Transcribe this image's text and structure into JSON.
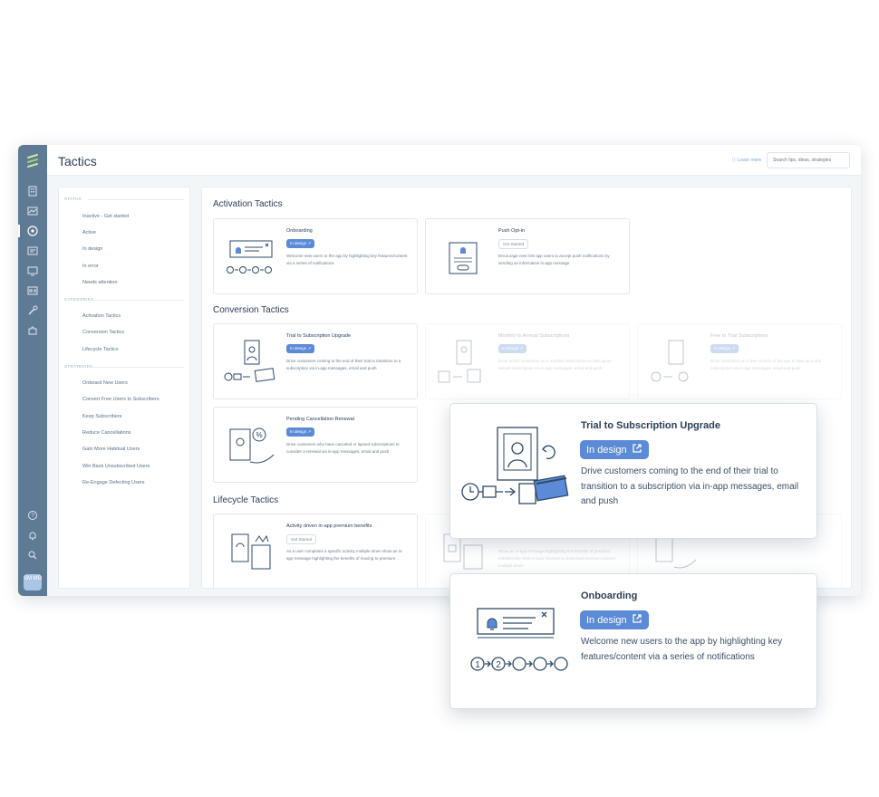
{
  "app": {
    "title": "Tactics",
    "learn_more": "Learn more",
    "search_placeholder": "Search tips, ideas, strategies",
    "avatar_initials": "SM MD"
  },
  "filters": {
    "status_header": "STATUS",
    "status": [
      "Inactive - Get started",
      "Active",
      "In design",
      "In error",
      "Needs attention"
    ],
    "categories_header": "CATEGORIES",
    "categories": [
      "Activation Tactics",
      "Conversion Tactics",
      "Lifecycle Tactics"
    ],
    "strategies_header": "STRATEGIES",
    "strategies": [
      "Onboard New Users",
      "Convert Free Users to Subscribers",
      "Keep Subscribers",
      "Reduce Cancellations",
      "Gain More Habitual Users",
      "Win Back Unsubscribed Users",
      "Re-Engage Defecting Users"
    ]
  },
  "sections": {
    "activation": "Activation Tactics",
    "conversion": "Conversion Tactics",
    "lifecycle": "Lifecycle Tactics"
  },
  "cards": {
    "onboarding": {
      "title": "Onboarding",
      "badge": "In design ↗",
      "desc": "Welcome new users to the app by highlighting key features/content via a series of notifications"
    },
    "push": {
      "title": "Push Opt-in",
      "badge": "Get Started",
      "desc": "Encourage new iOS app users to accept push notifications by sending an informative in-app message"
    },
    "trial": {
      "title": "Trial to Subscription Upgrade",
      "badge": "In design ↗",
      "desc": "Drive customers coming to the end of their trial to transition to a subscription via in-app messages, email and push"
    },
    "monthly": {
      "title": "Monthly to Annual Subscriptions",
      "badge": "In design ↗",
      "desc": "Drive active customers on a monthly subscription to take up an annual subscription via in-app messages, email and push"
    },
    "freetrial": {
      "title": "Free to Trial Subscriptions",
      "badge": "In design ↗",
      "desc": "Drive customers on a free version of the app to take up a trial subscription via in-app messages, email and push"
    },
    "pending": {
      "title": "Pending Cancellation Renewal",
      "badge": "In design ↗",
      "desc": "Drive customers who have canceled or lapsed subscriptions to consider a renewal via in-app messages, email and push"
    },
    "activity": {
      "title": "Activity driven in-app premium benefits",
      "badge": "Get Started",
      "desc": "As a user completes a specific activity multiple times show an in-app message highlighting the benefits of moving to premium"
    },
    "lifecycle2": {
      "desc": "Show an in-app message highlighting the benefits of premium membership when a user chooses to download premium content multiple times"
    }
  },
  "popups": {
    "trial": {
      "title": "Trial to Subscription Upgrade",
      "badge": "In design",
      "desc": "Drive customers coming to the end of their trial to transition to a subscription via in-app messages, email and push"
    },
    "onboarding": {
      "title": "Onboarding",
      "badge": "In design",
      "desc": "Welcome new users to the app by highlighting key features/content via a series of notifications"
    }
  },
  "icons": {
    "rail": [
      "building-icon",
      "chart-icon",
      "target-icon",
      "message-icon",
      "screen-icon",
      "id-card-icon",
      "tools-icon",
      "puzzle-icon",
      "help-icon",
      "bell-icon",
      "search-icon"
    ],
    "badge": "external-link-icon"
  },
  "colors": {
    "rail": "#5e7a94",
    "badge": "#5b8ad6",
    "illustration": "#2f4a68"
  }
}
